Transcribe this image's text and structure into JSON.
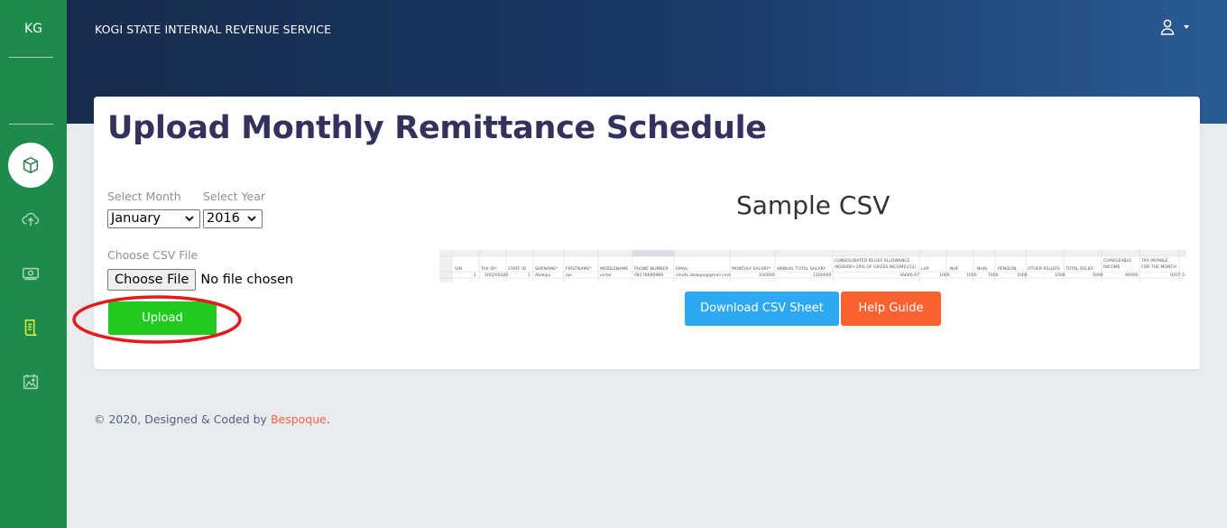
{
  "sidebar": {
    "logo": "KG",
    "items": [
      {
        "icon": "box-icon",
        "active": true
      },
      {
        "icon": "cloud-upload-icon"
      },
      {
        "icon": "cash-icon"
      },
      {
        "icon": "document-icon"
      },
      {
        "icon": "calendar-image-icon"
      }
    ]
  },
  "header": {
    "brand": "KOGI STATE INTERNAL REVENUE SERVICE",
    "user_icon": "user-icon"
  },
  "card": {
    "title": "Upload Monthly Remittance Schedule",
    "month_label": "Select Month",
    "month_value": "January",
    "year_label": "Select Year",
    "year_value": "2016",
    "file_label": "Choose CSV File",
    "file_button": "Choose File",
    "file_status": "No file chosen",
    "upload_label": "Upload",
    "sample_title": "Sample CSV",
    "download_label": "Download CSV Sheet",
    "help_label": "Help Guide"
  },
  "footer": {
    "text": "© 2020, Designed & Coded by ",
    "link": "Bespoque",
    "suffix": "."
  },
  "colors": {
    "sidebar": "#1e8a4c",
    "upload": "#22c91e",
    "download": "#2da9f4",
    "help": "#fb6231",
    "annotation": "#e31b1b"
  }
}
